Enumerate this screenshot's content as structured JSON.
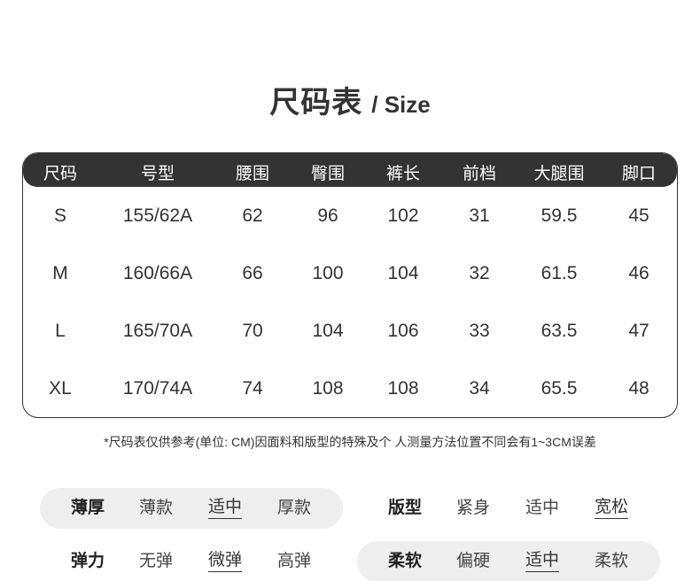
{
  "title": {
    "cn": "尺码表",
    "en": "/ Size"
  },
  "table": {
    "headers": [
      "尺码",
      "号型",
      "腰围",
      "臀围",
      "裤长",
      "前档",
      "大腿围",
      "脚口"
    ],
    "rows": [
      [
        "S",
        "155/62A",
        "62",
        "96",
        "102",
        "31",
        "59.5",
        "45"
      ],
      [
        "M",
        "160/66A",
        "66",
        "100",
        "104",
        "32",
        "61.5",
        "46"
      ],
      [
        "L",
        "165/70A",
        "70",
        "104",
        "106",
        "33",
        "63.5",
        "47"
      ],
      [
        "XL",
        "170/74A",
        "74",
        "108",
        "108",
        "34",
        "65.5",
        "48"
      ]
    ]
  },
  "note": "*尺码表仅供参考(单位: CM)因面料和版型的特殊及个 人测量方法位置不同会有1~3CM误差",
  "attributes": {
    "thickness": {
      "label": "薄厚",
      "options": [
        "薄款",
        "适中",
        "厚款"
      ],
      "selected": "适中"
    },
    "fit": {
      "label": "版型",
      "options": [
        "紧身",
        "适中",
        "宽松"
      ],
      "selected": "宽松"
    },
    "elasticity": {
      "label": "弹力",
      "options": [
        "无弹",
        "微弹",
        "高弹"
      ],
      "selected": "微弹"
    },
    "softness": {
      "label": "柔软",
      "options": [
        "偏硬",
        "适中",
        "柔软"
      ],
      "selected": "适中"
    }
  },
  "colors": {
    "header_bg": "#333333",
    "pill_bg": "#eeeeee",
    "text": "#333333"
  }
}
